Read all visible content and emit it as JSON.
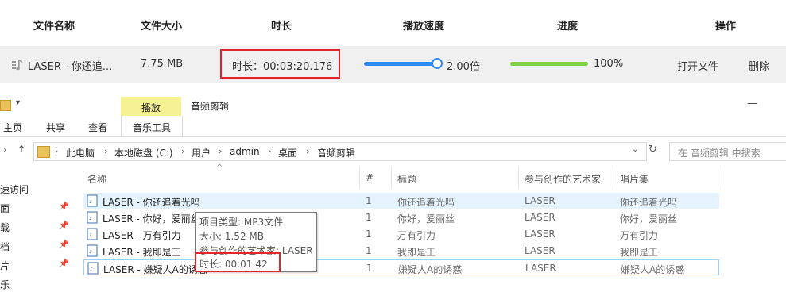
{
  "converter": {
    "columns": [
      "文件名称",
      "文件大小",
      "时长",
      "播放速度",
      "进度",
      "操作"
    ],
    "row": {
      "icon": "music-note-icon",
      "name": "LASER - 你还追...",
      "size": "7.75 MB",
      "duration": "时长：00:03:20.176",
      "speed": "2.00倍",
      "speed_slider_fraction": 0.95,
      "progress": "100%",
      "progress_fraction": 1.0,
      "open_label": "打开文件",
      "delete_label": "删除"
    },
    "accent": "#2d8cf0",
    "progress_color": "#7fd14a",
    "highlight_color": "#e0262b"
  },
  "explorer": {
    "ribbon": {
      "context_tab": "播放",
      "window_title": "音频剪辑",
      "tabs": [
        "主页",
        "共享",
        "查看",
        "音乐工具"
      ]
    },
    "address": {
      "crumbs": [
        "此电脑",
        "本地磁盘 (C:)",
        "用户",
        "admin",
        "桌面",
        "音频剪辑"
      ],
      "search_placeholder": "在 音频剪辑 中搜索"
    },
    "nav": [
      "速访问",
      "面",
      "载",
      "档",
      "片",
      "乐"
    ],
    "columns": [
      "名称",
      "#",
      "标题",
      "参与创作的艺术家",
      "唱片集"
    ],
    "files": [
      {
        "name": "LASER - 你还追着光吗",
        "num": "1",
        "title": "你还追着光吗",
        "artist": "LASER",
        "album": "你还追着光吗"
      },
      {
        "name": "LASER - 你好，爱丽丝",
        "num": "1",
        "title": "你好，爱丽丝",
        "artist": "LASER",
        "album": "你好，爱丽丝"
      },
      {
        "name": "LASER - 万有引力",
        "num": "1",
        "title": "万有引力",
        "artist": "LASER",
        "album": "万有引力"
      },
      {
        "name": "LASER - 我即是王",
        "num": "1",
        "title": "我即是王",
        "artist": "LASER",
        "album": "我即是王"
      },
      {
        "name": "LASER - 嫌疑人A的诱惑",
        "num": "1",
        "title": "嫌疑人A的诱惑",
        "artist": "LASER",
        "album": "嫌疑人A的诱惑"
      }
    ],
    "tooltip": {
      "type": "项目类型: MP3文件",
      "size": "大小: 1.52 MB",
      "artist": "参与创作的艺术家: LASER",
      "duration": "时长: 00:01:42"
    }
  }
}
